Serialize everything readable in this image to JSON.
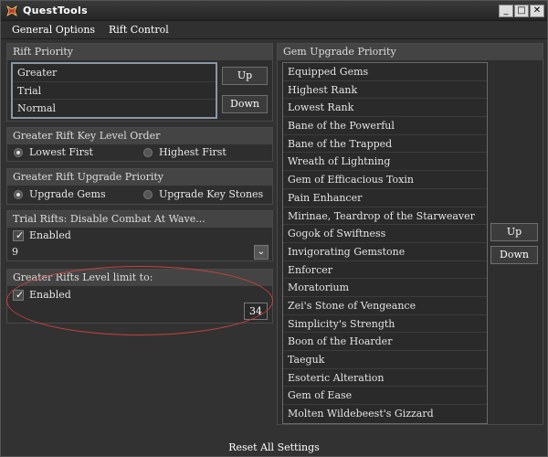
{
  "window": {
    "title": "QuestTools"
  },
  "menu": [
    "General Options",
    "Rift Control"
  ],
  "rift_priority": {
    "header": "Rift Priority",
    "items": [
      "Greater",
      "Trial",
      "Normal"
    ],
    "up_label": "Up",
    "down_label": "Down"
  },
  "key_level_order": {
    "header": "Greater Rift Key Level Order",
    "options": [
      "Lowest First",
      "Highest First"
    ],
    "selected": "Lowest First"
  },
  "upgrade_priority": {
    "header": "Greater Rift Upgrade Priority",
    "options": [
      "Upgrade Gems",
      "Upgrade Key Stones"
    ],
    "selected": "Upgrade Gems"
  },
  "trial_rifts": {
    "header": "Trial Rifts: Disable Combat At Wave...",
    "enabled_label": "Enabled",
    "enabled": true,
    "wave": "9"
  },
  "level_limit": {
    "header": "Greater Rifts Level limit to:",
    "enabled_label": "Enabled",
    "enabled": true,
    "value": "34"
  },
  "gem_priority": {
    "header": "Gem Upgrade Priority",
    "items": [
      "Equipped Gems",
      "Highest Rank",
      "Lowest Rank",
      "Bane of the Powerful",
      "Bane of the Trapped",
      "Wreath of Lightning",
      "Gem of Efficacious Toxin",
      "Pain Enhancer",
      "Mirinae, Teardrop of the Starweaver",
      "Gogok of Swiftness",
      "Invigorating Gemstone",
      "Enforcer",
      "Moratorium",
      "Zei's Stone of Vengeance",
      "Simplicity's Strength",
      "Boon of the Hoarder",
      "Taeguk",
      "Esoteric Alteration",
      "Gem of Ease",
      "Molten Wildebeest's Gizzard"
    ],
    "up_label": "Up",
    "down_label": "Down"
  },
  "reset_label": "Reset All Settings",
  "colors": {
    "background": "#323232",
    "header": "#444444",
    "annotation": "#c84040"
  }
}
